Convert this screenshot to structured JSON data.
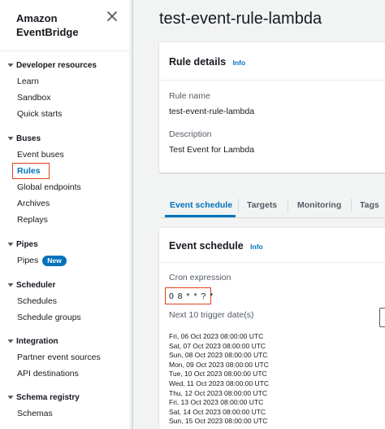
{
  "sidebar": {
    "brand": "Amazon EventBridge",
    "sections": [
      {
        "title": "Developer resources",
        "items": [
          "Learn",
          "Sandbox",
          "Quick starts"
        ]
      },
      {
        "title": "Buses",
        "items": [
          "Event buses",
          "Rules",
          "Global endpoints",
          "Archives",
          "Replays"
        ]
      },
      {
        "title": "Pipes",
        "items": [
          "Pipes"
        ],
        "badge": "New"
      },
      {
        "title": "Scheduler",
        "items": [
          "Schedules",
          "Schedule groups"
        ]
      },
      {
        "title": "Integration",
        "items": [
          "Partner event sources",
          "API destinations"
        ]
      },
      {
        "title": "Schema registry",
        "items": [
          "Schemas"
        ]
      }
    ],
    "active_item": "Rules"
  },
  "page": {
    "title": "test-event-rule-lambda"
  },
  "rule_details": {
    "heading": "Rule details",
    "info": "Info",
    "rule_name_label": "Rule name",
    "rule_name": "test-event-rule-lambda",
    "description_label": "Description",
    "description": "Test Event for Lambda"
  },
  "tabs": [
    "Event schedule",
    "Targets",
    "Monitoring",
    "Tags"
  ],
  "active_tab": "Event schedule",
  "event_schedule": {
    "heading": "Event schedule",
    "info": "Info",
    "cron_label": "Cron expression",
    "cron_value": "0 8 * * ? *",
    "next_label": "Next 10 trigger date(s)",
    "dates": [
      "Fri, 06 Oct 2023 08:00:00 UTC",
      "Sat, 07 Oct 2023 08:00:00 UTC",
      "Sun, 08 Oct 2023 08:00:00 UTC",
      "Mon, 09 Oct 2023 08:00:00 UTC",
      "Tue, 10 Oct 2023 08:00:00 UTC",
      "Wed, 11 Oct 2023 08:00:00 UTC",
      "Thu, 12 Oct 2023 08:00:00 UTC",
      "Fri, 13 Oct 2023 08:00:00 UTC",
      "Sat, 14 Oct 2023 08:00:00 UTC",
      "Sun, 15 Oct 2023 08:00:00 UTC"
    ]
  },
  "colors": {
    "accent": "#0073bb",
    "highlight_box": "#e0411f",
    "background": "#f2f3f3"
  },
  "icons": {
    "close": "close-icon",
    "section_toggle": "caret-down-icon"
  }
}
